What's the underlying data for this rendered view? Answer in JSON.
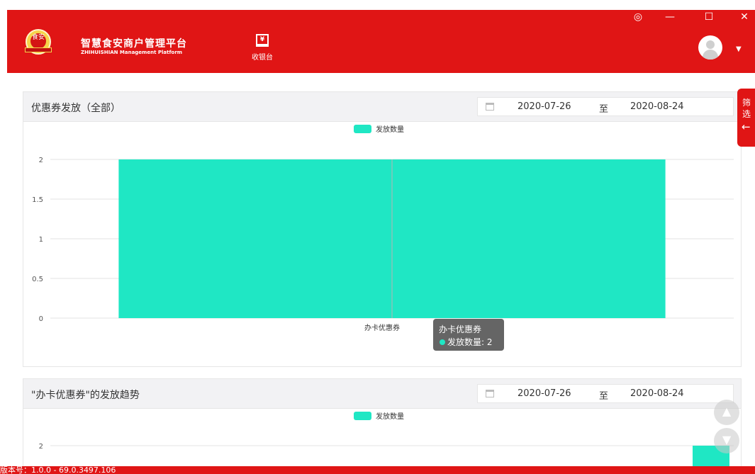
{
  "header": {
    "logo_top_text": "食安",
    "title": "智慧食安商户管理平台",
    "subtitle": "ZHIHUISHIAN Management Platform",
    "cashier_label": "收银台",
    "cashier_icon": "yen-register-icon",
    "window_controls": {
      "settings": "◎",
      "minimize": "—",
      "maximize": "☐",
      "close": "✕"
    },
    "caret": "▼"
  },
  "filter_tab": {
    "label_line1": "筛",
    "label_line2": "选",
    "arrow": "←"
  },
  "panels": [
    {
      "title": "优惠券发放（全部）",
      "date_start": "2020-07-26",
      "date_sep": "至",
      "date_end": "2020-08-24"
    },
    {
      "title": "\"办卡优惠券\"的发放趋势",
      "date_start": "2020-07-26",
      "date_sep": "至",
      "date_end": "2020-08-24"
    }
  ],
  "chart_data": [
    {
      "type": "bar",
      "categories": [
        "办卡优惠券"
      ],
      "series": [
        {
          "name": "发放数量",
          "values": [
            2
          ]
        }
      ],
      "ylim": [
        0,
        2
      ],
      "yticks": [
        "0",
        "0.5",
        "1",
        "1.5",
        "2"
      ],
      "tooltip": {
        "title": "办卡优惠券",
        "label": "发放数量: 2"
      },
      "color": "#1fe7c4",
      "legend_position": "top-center",
      "grid": true
    },
    {
      "type": "bar",
      "categories": [],
      "series": [
        {
          "name": "发放数量",
          "values": [
            2
          ]
        }
      ],
      "ylim": [
        0,
        2
      ],
      "yticks": [
        "2"
      ],
      "color": "#1fe7c4",
      "legend_position": "top-center",
      "grid": true
    }
  ],
  "scroll_buttons": {
    "up": "▲",
    "down": "▼"
  },
  "footer": {
    "version": "版本号：1.0.0 - 69.0.3497.106"
  }
}
